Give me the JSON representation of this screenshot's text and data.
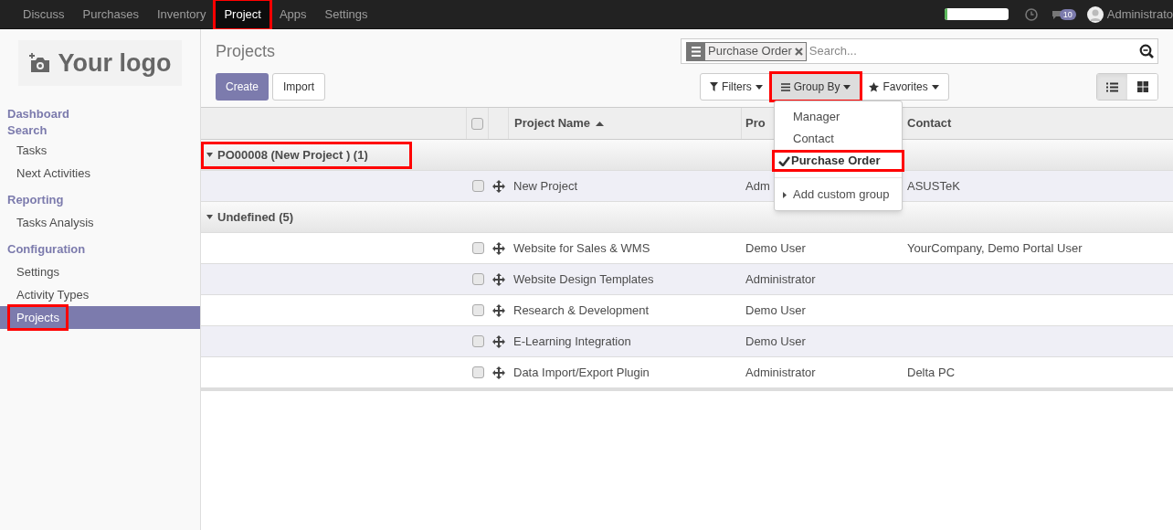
{
  "top_menu": [
    {
      "label": "Discuss",
      "selected": false,
      "highlighted": false
    },
    {
      "label": "Purchases",
      "selected": false,
      "highlighted": false
    },
    {
      "label": "Inventory",
      "selected": false,
      "highlighted": false
    },
    {
      "label": "Project",
      "selected": true,
      "highlighted": true
    },
    {
      "label": "Apps",
      "selected": false,
      "highlighted": false
    },
    {
      "label": "Settings",
      "selected": false,
      "highlighted": false
    }
  ],
  "systray": {
    "progress": {
      "level": 0.04
    },
    "messages_count": "10",
    "user": "Administrato"
  },
  "logo": "Your logo",
  "sidebar": [
    {
      "kind": "header",
      "label": "Dashboard",
      "selected": false,
      "highlighted": false
    },
    {
      "kind": "header",
      "label": "Search",
      "selected": false,
      "highlighted": false
    },
    {
      "kind": "item",
      "label": "Tasks",
      "selected": false,
      "highlighted": false
    },
    {
      "kind": "item",
      "label": "Next Activities",
      "selected": false,
      "highlighted": false
    },
    {
      "kind": "section",
      "label": "Reporting",
      "selected": false,
      "highlighted": false
    },
    {
      "kind": "item",
      "label": "Tasks Analysis",
      "selected": false,
      "highlighted": false
    },
    {
      "kind": "section",
      "label": "Configuration",
      "selected": false,
      "highlighted": false
    },
    {
      "kind": "item",
      "label": "Settings",
      "selected": false,
      "highlighted": false
    },
    {
      "kind": "item",
      "label": "Activity Types",
      "selected": false,
      "highlighted": false
    },
    {
      "kind": "item",
      "label": "Projects",
      "selected": true,
      "highlighted": true
    }
  ],
  "breadcrumb": "Projects",
  "buttons": [
    {
      "label": "Create",
      "kind": "primary"
    },
    {
      "label": "Import",
      "kind": "secondary"
    }
  ],
  "search": {
    "facet": "Purchase Order",
    "placeholder": "Search..."
  },
  "search_buttons": [
    {
      "label": "Filters",
      "kind": "filter",
      "selected": false,
      "highlighted": false
    },
    {
      "label": "Group By",
      "kind": "groupby",
      "selected": true,
      "highlighted": true
    },
    {
      "label": "Favorites",
      "kind": "star",
      "selected": false,
      "highlighted": false
    }
  ],
  "view_switch": [
    {
      "kind": "list",
      "selected": true
    },
    {
      "kind": "kanban",
      "selected": false
    }
  ],
  "group_by_menu": {
    "items": [
      {
        "kind": "option",
        "label": "Manager",
        "checked": false,
        "highlighted": false
      },
      {
        "kind": "option",
        "label": "Contact",
        "checked": false,
        "highlighted": false
      },
      {
        "kind": "option",
        "label": "Purchase Order",
        "checked": true,
        "highlighted": true
      },
      {
        "kind": "custom",
        "label": "Add custom group",
        "checked": false,
        "highlighted": false
      }
    ]
  },
  "table": {
    "select_all_checked": false,
    "columns": [
      {
        "label": "Project Name",
        "sorted": true
      },
      {
        "label": "Pro",
        "sorted": false
      },
      {
        "label": "Contact",
        "sorted": false
      }
    ],
    "groups": [
      {
        "label": "PO00008 (New Project ) (1)",
        "expanded": true,
        "highlighted": true,
        "rows": [
          {
            "name": "New Project",
            "manager": "Adm",
            "contact": "ASUSTeK",
            "checked": false
          }
        ]
      },
      {
        "label": "Undefined (5)",
        "expanded": true,
        "highlighted": false,
        "rows": [
          {
            "name": "Website for Sales & WMS",
            "manager": "Demo User",
            "contact": "YourCompany, Demo Portal User",
            "checked": false
          },
          {
            "name": "Website Design Templates",
            "manager": "Administrator",
            "checked": false
          },
          {
            "name": "Research & Development",
            "manager": "Demo User",
            "checked": false
          },
          {
            "name": "E-Learning Integration",
            "manager": "Demo User",
            "checked": false
          },
          {
            "name": "Data Import/Export Plugin",
            "manager": "Administrator",
            "contact": "Delta PC",
            "checked": false
          }
        ]
      }
    ]
  }
}
